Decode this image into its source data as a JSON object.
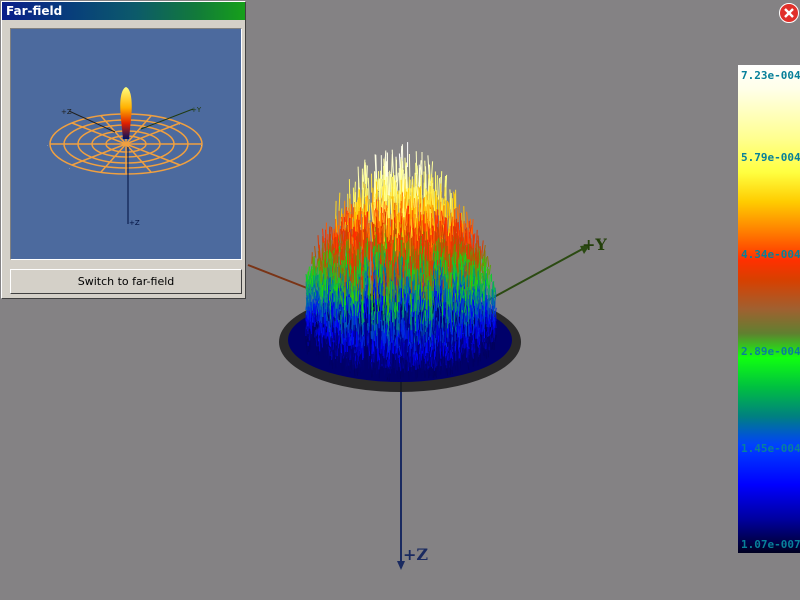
{
  "scene": {
    "axes": {
      "y_label": "+Y",
      "z_label": "+Z"
    }
  },
  "far_field_panel": {
    "title": "Far-field",
    "inset_axes": {
      "z_label": "+Z",
      "y_label": "+Y",
      "zn_label": "+Z"
    },
    "button_label": "Switch to far-field"
  },
  "colorbar": {
    "labels": [
      "7.23e-004",
      "5.79e-004",
      "4.34e-004",
      "2.89e-004",
      "1.45e-004",
      "1.07e-007"
    ],
    "label_colors": {
      "primary": "#08809a"
    }
  },
  "colors": {
    "background": "#848284",
    "panel_blue": "#4c6a9e",
    "close_red": "#e0302a"
  }
}
